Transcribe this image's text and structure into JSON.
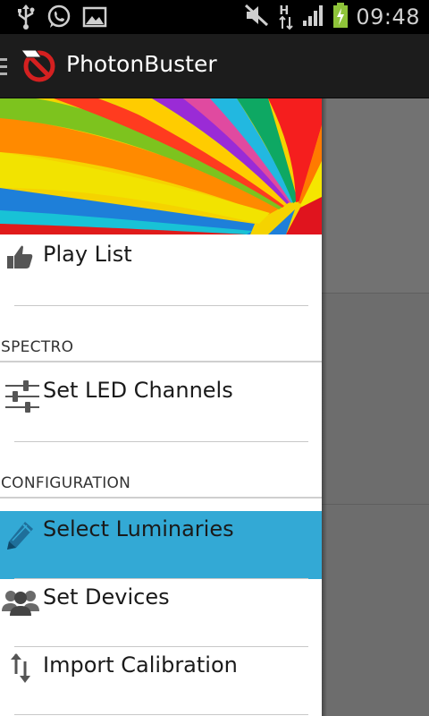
{
  "status_bar": {
    "time": "09:48",
    "icons": [
      "usb-icon",
      "whatsapp-icon",
      "gallery-icon",
      "mute-icon",
      "hspa-data-icon",
      "signal-icon",
      "battery-charging-icon"
    ],
    "network_label": "H"
  },
  "action_bar": {
    "title": "PhotonBuster"
  },
  "drawer": {
    "items": [
      {
        "label": "Play List",
        "icon": "thumbs-up-icon"
      }
    ],
    "sections": [
      {
        "header": "SPECTRO",
        "items": [
          {
            "label": "Set LED Channels",
            "icon": "sliders-icon"
          }
        ]
      },
      {
        "header": "CONFIGURATION",
        "items": [
          {
            "label": "Select Luminaries",
            "icon": "pencil-icon",
            "selected": true
          },
          {
            "label": "Set Devices",
            "icon": "group-icon"
          },
          {
            "label": "Import Calibration",
            "icon": "import-arrows-icon"
          }
        ]
      }
    ]
  },
  "colors": {
    "selected_item": "#33a9d5",
    "action_bar": "#1c1c1c",
    "battery": "#8fc43a"
  }
}
